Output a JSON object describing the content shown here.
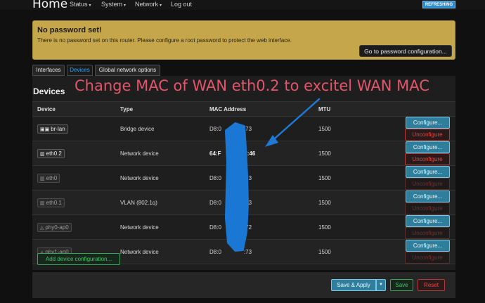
{
  "header": {
    "brand": "Home",
    "menu": [
      {
        "label": "Status",
        "has_caret": true
      },
      {
        "label": "System",
        "has_caret": true
      },
      {
        "label": "Network",
        "has_caret": true
      },
      {
        "label": "Log out",
        "has_caret": false
      }
    ],
    "status_badge": "REFRESHING"
  },
  "alert": {
    "title": "No password set!",
    "message": "There is no password set on this router. Please configure a root password to protect the web interface.",
    "button": "Go to password configuration..."
  },
  "tabs": [
    {
      "label": "Interfaces",
      "active": false
    },
    {
      "label": "Devices",
      "active": true
    },
    {
      "label": "Global network options",
      "active": false
    }
  ],
  "devices": {
    "title": "Devices",
    "columns": [
      "Device",
      "Type",
      "MAC Address",
      "MTU",
      ""
    ],
    "rows": [
      {
        "name": "br-lan",
        "icon": "bridge-icon",
        "type": "Bridge device",
        "mac": "D8:0 ... :73",
        "mac_left": "D8:0",
        "mac_right": ":73",
        "mtu": "1500",
        "configure": "Configure...",
        "unconfigure": "Unconfigure",
        "unconfigure_enabled": true,
        "dim": false,
        "mac_bold": false
      },
      {
        "name": "eth0.2",
        "icon": "ethernet-icon",
        "type": "Network device",
        "mac": "64:F ... E:46",
        "mac_left": "64:F",
        "mac_right": "E:46",
        "mtu": "1500",
        "configure": "Configure...",
        "unconfigure": "Unconfigure",
        "unconfigure_enabled": true,
        "dim": false,
        "mac_bold": true
      },
      {
        "name": "eth0",
        "icon": "ethernet-icon",
        "type": "Network device",
        "mac": "D8:0 ... :73",
        "mac_left": "D8:0",
        "mac_right": ":73",
        "mtu": "1500",
        "configure": "Configure...",
        "unconfigure": "Unconfigure",
        "unconfigure_enabled": false,
        "dim": true,
        "mac_bold": false
      },
      {
        "name": "eth0.1",
        "icon": "ethernet-icon",
        "type": "VLAN (802.1q)",
        "mac": "D8:0 ... :73",
        "mac_left": "D8:0",
        "mac_right": ":73",
        "mtu": "1500",
        "configure": "Configure...",
        "unconfigure": "Unconfigure",
        "unconfigure_enabled": false,
        "dim": true,
        "mac_bold": false
      },
      {
        "name": "phy0-ap0",
        "icon": "wifi-icon",
        "type": "Network device",
        "mac": "D8:0 ... :72",
        "mac_left": "D8:0",
        "mac_right": ":72",
        "mtu": "1500",
        "configure": "Configure...",
        "unconfigure": "Unconfigure",
        "unconfigure_enabled": false,
        "dim": true,
        "mac_bold": false
      },
      {
        "name": "phy1-ap0",
        "icon": "wifi-icon",
        "type": "Network device",
        "mac": "D8:0 ... :73",
        "mac_left": "D8:0",
        "mac_right": ":73",
        "mtu": "1500",
        "configure": "Configure...",
        "unconfigure": "Unconfigure",
        "unconfigure_enabled": false,
        "dim": true,
        "mac_bold": false
      }
    ],
    "add_button": "Add device configuration..."
  },
  "footer": {
    "save_apply": "Save & Apply",
    "save": "Save",
    "reset": "Reset"
  },
  "annotation": {
    "text": "Change MAC of WAN eth0.2 to excitel WAN MAC",
    "color": "#e4556b",
    "arrow_color": "#1f7ad6",
    "redaction_color": "#1a78d4"
  }
}
